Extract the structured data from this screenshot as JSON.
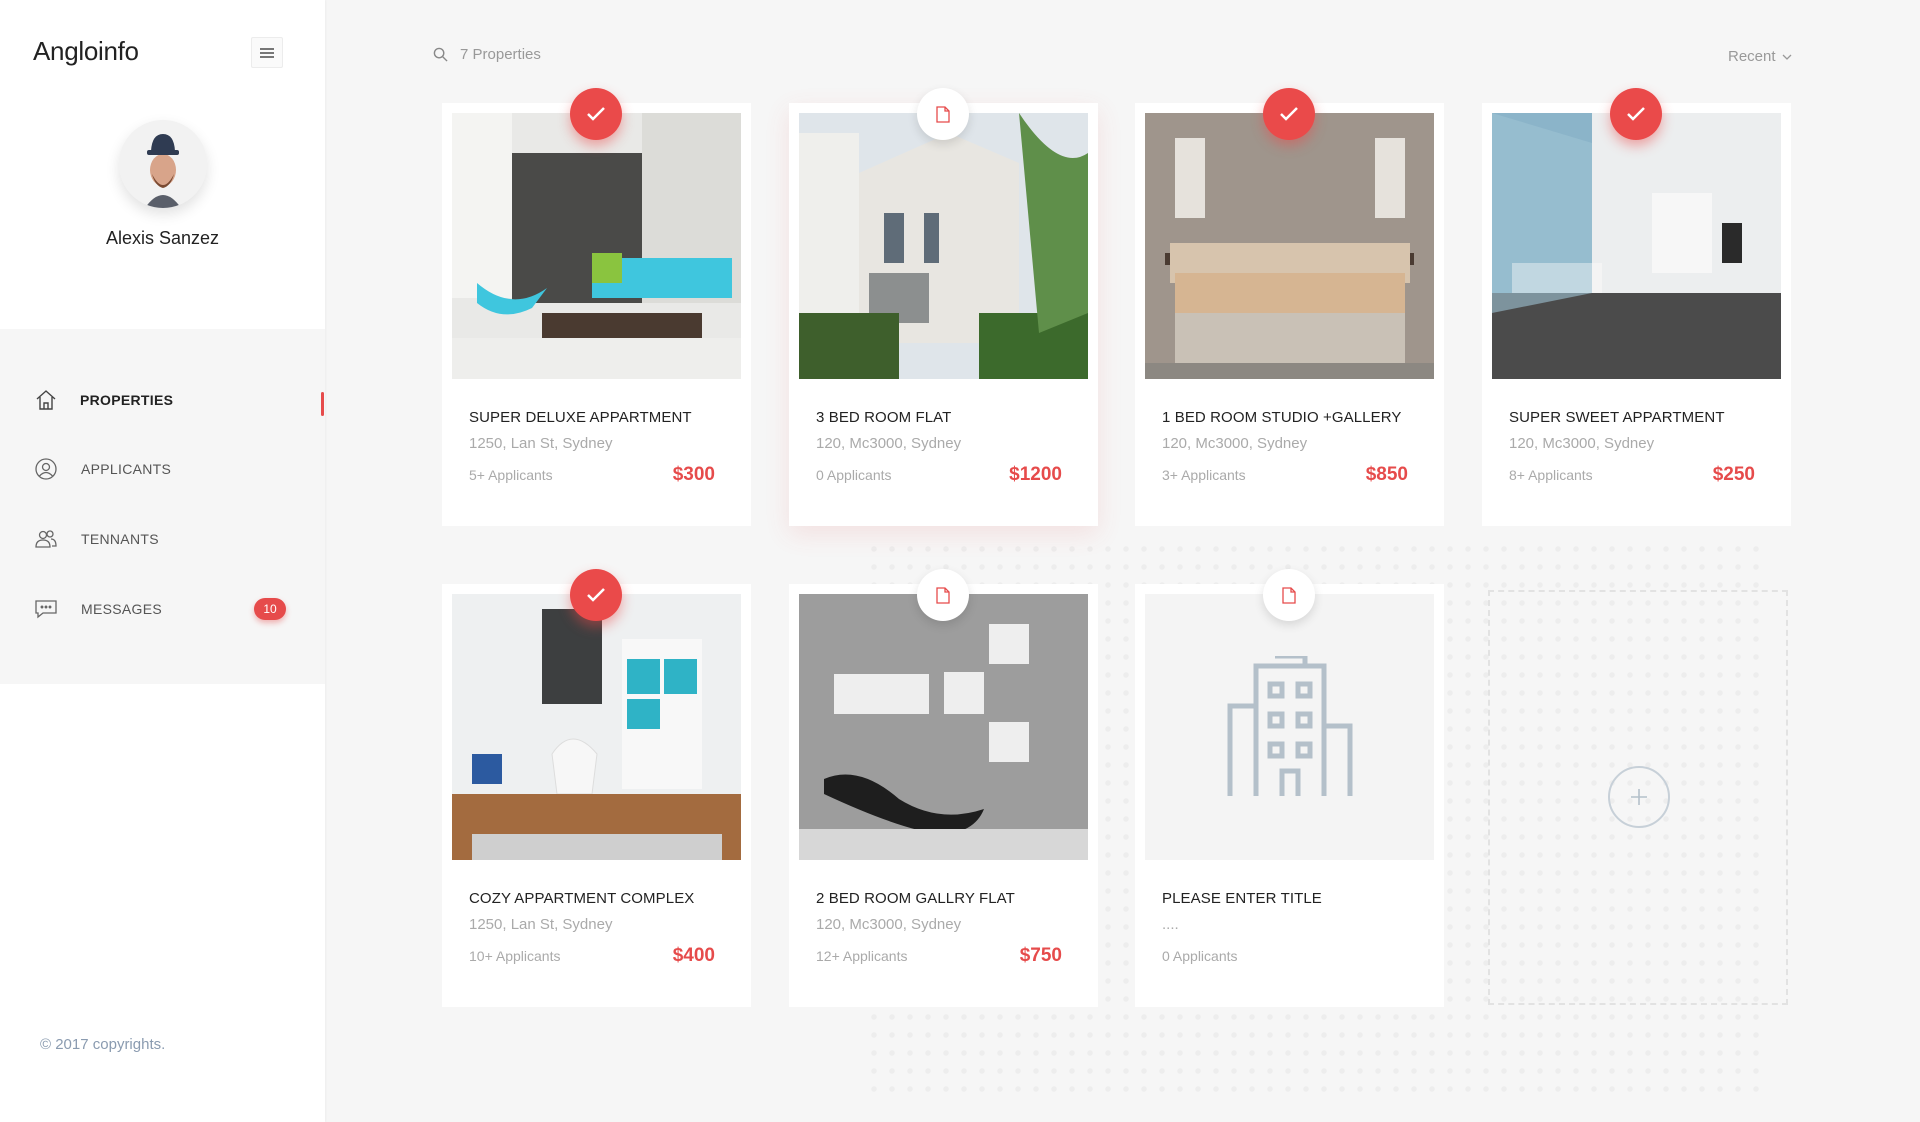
{
  "app": {
    "brand": "Angloinfo"
  },
  "user": {
    "name": "Alexis Sanzez"
  },
  "nav": [
    {
      "label": "PROPERTIES",
      "icon": "home-icon",
      "active": true
    },
    {
      "label": "APPLICANTS",
      "icon": "user-circle-icon"
    },
    {
      "label": "TENNANTS",
      "icon": "users-icon"
    },
    {
      "label": "MESSAGES",
      "icon": "chat-icon",
      "badge": "10"
    }
  ],
  "footer": "© 2017 copyrights.",
  "toolbar": {
    "count_text": "7 Properties",
    "sort_label": "Recent"
  },
  "properties": [
    {
      "title": "SUPER DELUXE APPARTMENT",
      "address": "1250, Lan St, Sydney",
      "applicants": "5+ Applicants",
      "price": "$300",
      "status": "completed"
    },
    {
      "title": "3 BED ROOM FLAT",
      "address": "120, Mc3000, Sydney",
      "applicants": "0 Applicants",
      "price": "$1200",
      "status": "draft"
    },
    {
      "title": "1 BED ROOM STUDIO +GALLERY",
      "address": "120, Mc3000, Sydney",
      "applicants": "3+ Applicants",
      "price": "$850",
      "status": "completed"
    },
    {
      "title": "SUPER SWEET APPARTMENT",
      "address": "120, Mc3000, Sydney",
      "applicants": "8+ Applicants",
      "price": "$250",
      "status": "completed"
    },
    {
      "title": "COZY APPARTMENT COMPLEX",
      "address": "1250, Lan St, Sydney",
      "applicants": "10+ Applicants",
      "price": "$400",
      "status": "completed"
    },
    {
      "title": "2 BED ROOM GALLRY FLAT",
      "address": "120, Mc3000, Sydney",
      "applicants": "12+ Applicants",
      "price": "$750",
      "status": "draft"
    },
    {
      "title": "PLEASE ENTER TITLE",
      "address": "....",
      "applicants": "0 Applicants",
      "price": "",
      "status": "draft"
    }
  ],
  "colors": {
    "accent": "#e64b4b",
    "sidebar": "#ffffff",
    "background": "#f6f6f6"
  }
}
